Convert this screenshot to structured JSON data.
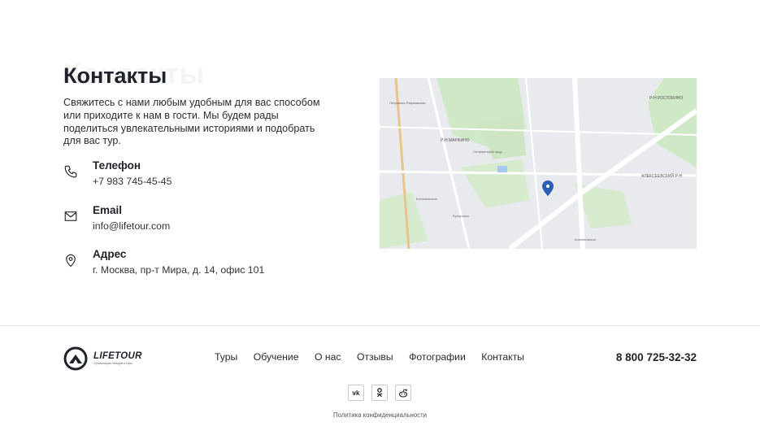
{
  "contacts": {
    "title": "Контакты",
    "title_shadow": "Контакты",
    "lead": "Свяжитесь с нами любым удобным для вас способом или приходите к нам в гости. Мы будем рады поделиться увлекательными историями и подобрать для вас тур.",
    "items": [
      {
        "icon": "phone-icon",
        "label": "Телефон",
        "value": "+7 983 745-45-45"
      },
      {
        "icon": "envelope-icon",
        "label": "Email",
        "value": "info@lifetour.com"
      },
      {
        "icon": "location-pin-icon",
        "label": "Адрес",
        "value": "г. Москва, пр-т Мира, д. 14, офис 101"
      }
    ]
  },
  "map": {
    "labels": [
      "Р-Н МАРФИНО",
      "АЛЕКСЕЕВСКИЙ Р-Н",
      "Р-Н РОСТОКИНО",
      "Останкинский пруд",
      "Ботаническая",
      "Бутырская",
      "Петровско-Разумовская",
      "Алексеевская"
    ]
  },
  "footer": {
    "logo_name": "LIFETOUR",
    "logo_tagline": "Организация походов в горы",
    "nav": [
      "Туры",
      "Обучение",
      "О нас",
      "Отзывы",
      "Фотографии",
      "Контакты"
    ],
    "phone": "8 800 725-32-32",
    "socials": [
      {
        "icon": "vk-icon",
        "glyph": "vk"
      },
      {
        "icon": "odnoklassniki-icon",
        "glyph": "ok"
      },
      {
        "icon": "reddit-icon",
        "glyph": "r"
      }
    ],
    "privacy": "Политика конфиденциальности"
  },
  "colors": {
    "text": "#1f2228",
    "pin": "#2b5fb7",
    "map_bg": "#e9eaee",
    "park": "#cfe8c5"
  }
}
